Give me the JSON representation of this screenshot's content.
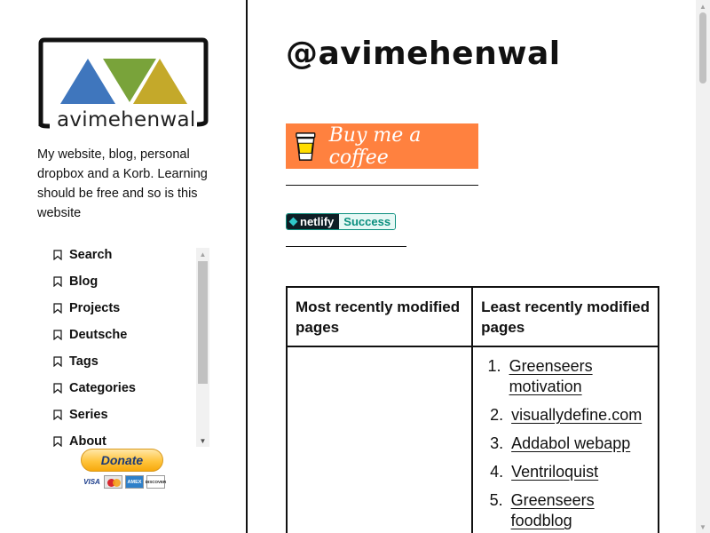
{
  "sidebar": {
    "logo_text": "avimehenwal",
    "tagline": "My website, blog, personal dropbox and a Korb. Learning should be free and so is this website",
    "nav": [
      {
        "label": "Search"
      },
      {
        "label": "Blog"
      },
      {
        "label": "Projects"
      },
      {
        "label": "Deutsche"
      },
      {
        "label": "Tags"
      },
      {
        "label": "Categories"
      },
      {
        "label": "Series"
      },
      {
        "label": "About"
      }
    ],
    "donate_label": "Donate",
    "cards": [
      "VISA",
      "MasterCard",
      "AMEX",
      "DISCOVER"
    ]
  },
  "main": {
    "title": "@avimehenwal",
    "coffee_label": "Buy me a coffee",
    "netlify": {
      "left": "netlify",
      "right": "Success"
    },
    "table": {
      "col1_header": "Most recently modified pages",
      "col2_header": "Least recently modified pages",
      "least_recent": [
        {
          "num": "1.",
          "label": "Greenseers motivation"
        },
        {
          "num": "2.",
          "label": "visuallydefine.com"
        },
        {
          "num": "3.",
          "label": "Addabol webapp"
        },
        {
          "num": "4.",
          "label": "Ventriloquist"
        },
        {
          "num": "5.",
          "label": "Greenseers foodblog"
        }
      ]
    }
  },
  "colors": {
    "logo_blue": "#3f76bd",
    "logo_green": "#79a33a",
    "logo_yellow": "#c4a92a",
    "coffee_orange": "#ff813f"
  }
}
